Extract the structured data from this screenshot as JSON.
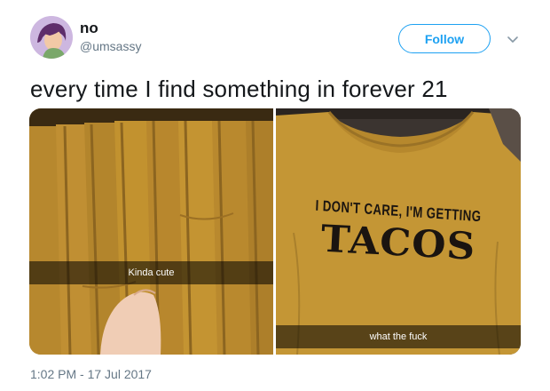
{
  "user": {
    "display_name": "no",
    "handle": "@umsassy"
  },
  "actions": {
    "follow_label": "Follow",
    "caret_icon": "chevron-down-icon"
  },
  "tweet": {
    "text": "every time I find something in forever 21",
    "timestamp": "1:02 PM - 17 Jul 2017"
  },
  "media": {
    "left_caption": "Kinda cute",
    "right_caption": "what the fuck",
    "shirt_print_line1": "I DON'T CARE, I'M GETTING",
    "shirt_print_line2": "TACOS"
  },
  "colors": {
    "accent": "#1da1f2",
    "mustard": "#b8862c",
    "text": "#14171a",
    "muted": "#657786"
  }
}
